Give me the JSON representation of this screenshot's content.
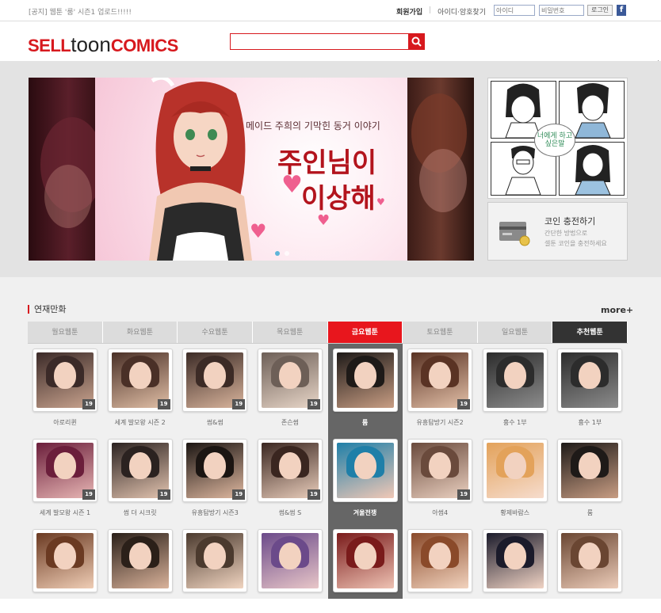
{
  "topbar": {
    "notice": "[공지] 웹툰 '룸' 시즌1 업로드!!!!!",
    "links": [
      "회원가입",
      "아이디·암호찾기"
    ],
    "id_placeholder": "아이디",
    "pw_placeholder": "비밀번호",
    "login_label": "로그인",
    "facebook": "f"
  },
  "header": {
    "logo_sell": "SELL",
    "logo_toon": "toon",
    "logo_comics": "COMICS",
    "search_value": ""
  },
  "banner": {
    "subtitle": "메이드 주희의 기막힌 동거 이야기",
    "title_line1": "주인님이",
    "title_line2": "이상해",
    "dots": 2,
    "active_dot": 1
  },
  "side_banner": {
    "bubble_text": "너에게 하고싶은말"
  },
  "coin": {
    "title": "코인 충전하기",
    "line1": "간단한 방법으로",
    "line2": "셀툰 코인을 충전하세요"
  },
  "section": {
    "title": "연재만화",
    "more": "more+"
  },
  "tabs": [
    {
      "label": "월요웹툰",
      "state": "normal"
    },
    {
      "label": "화요웹툰",
      "state": "normal"
    },
    {
      "label": "수요웹툰",
      "state": "normal"
    },
    {
      "label": "목요웹툰",
      "state": "normal"
    },
    {
      "label": "금요웹툰",
      "state": "active"
    },
    {
      "label": "토요웹툰",
      "state": "normal"
    },
    {
      "label": "일요웹툰",
      "state": "normal"
    },
    {
      "label": "추천웹툰",
      "state": "dark"
    }
  ],
  "comics": [
    [
      {
        "title": "아로리퀸",
        "badge": "19",
        "palette": [
          "#3b2a28",
          "#c9a38e"
        ]
      },
      {
        "title": "세계 발모왕 시즌 2",
        "badge": "19",
        "palette": [
          "#4a3027",
          "#e1bfa6"
        ]
      },
      {
        "title": "썸&썸",
        "badge": "19",
        "palette": [
          "#3c2b26",
          "#d9b49c"
        ]
      },
      {
        "title": "존슨썸",
        "badge": "19",
        "palette": [
          "#6d5f57",
          "#e8d6c8"
        ]
      },
      {
        "title": "룸",
        "badge": "",
        "palette": [
          "#1e1a18",
          "#c89d83"
        ]
      },
      {
        "title": "유흥탐방기 시즌2",
        "badge": "19",
        "palette": [
          "#5a3324",
          "#e3c0a8"
        ]
      },
      {
        "title": "흉수 1부",
        "badge": "",
        "palette": [
          "#2c2c2c",
          "#8c8c8c"
        ]
      },
      {
        "title": "흉수 1부",
        "badge": "",
        "palette": [
          "#2c2c2c",
          "#8c8c8c"
        ]
      }
    ],
    [
      {
        "title": "세계 발모왕 시즌 1",
        "badge": "19",
        "palette": [
          "#6b1e3b",
          "#e7b6b4"
        ]
      },
      {
        "title": "썸 더 시크릿",
        "badge": "19",
        "palette": [
          "#2b2220",
          "#e3c4b0"
        ]
      },
      {
        "title": "유흥탐방기 시즌3",
        "badge": "19",
        "palette": [
          "#1b1512",
          "#dfb8a0"
        ]
      },
      {
        "title": "썸&썸 S",
        "badge": "19",
        "palette": [
          "#3a2620",
          "#e9cdbb"
        ]
      },
      {
        "title": "겨울전쟁",
        "badge": "",
        "palette": [
          "#1f7fa8",
          "#f1c8b6"
        ]
      },
      {
        "title": "아썸4",
        "badge": "19",
        "palette": [
          "#6a4a3c",
          "#ead0c0"
        ]
      },
      {
        "title": "황제바람스",
        "badge": "",
        "palette": [
          "#e3a25a",
          "#f6dccd"
        ]
      },
      {
        "title": "룸",
        "badge": "",
        "palette": [
          "#1e1a18",
          "#c89d83"
        ]
      }
    ],
    [
      {
        "title": "",
        "badge": "",
        "palette": [
          "#6b3a22",
          "#efcdb5"
        ]
      },
      {
        "title": "",
        "badge": "",
        "palette": [
          "#2b2019",
          "#d9b29a"
        ]
      },
      {
        "title": "",
        "badge": "",
        "palette": [
          "#4b3a2e",
          "#f0d4c0"
        ]
      },
      {
        "title": "",
        "badge": "",
        "palette": [
          "#6b4a8a",
          "#e8c6c8"
        ]
      },
      {
        "title": "",
        "badge": "",
        "palette": [
          "#7a1b1b",
          "#eec2b3"
        ]
      },
      {
        "title": "",
        "badge": "",
        "palette": [
          "#8a4a2a",
          "#f1d2bd"
        ]
      },
      {
        "title": "",
        "badge": "",
        "palette": [
          "#1b1b2b",
          "#f0d3c4"
        ]
      },
      {
        "title": "",
        "badge": "",
        "palette": [
          "#6a4632",
          "#ecccb9"
        ]
      }
    ]
  ],
  "highlight_column": 4,
  "colors": {
    "brand_red": "#d7191e",
    "tab_active": "#e8161d",
    "tab_dark": "#333333"
  }
}
